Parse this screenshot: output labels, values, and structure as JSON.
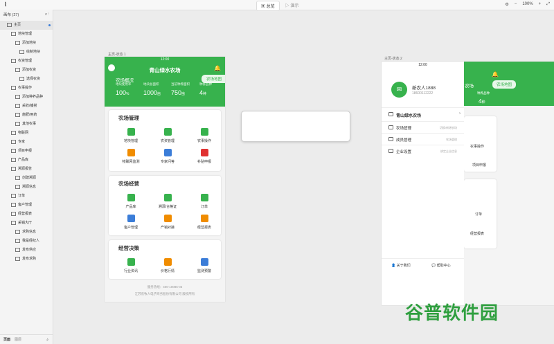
{
  "app": {
    "logo": "⌇"
  },
  "toolbar": {
    "tabs": [
      {
        "label": "总览"
      },
      {
        "label": "演示"
      }
    ],
    "zoom": "100%"
  },
  "sidebar": {
    "header": "画布 (27)",
    "items": [
      {
        "label": "主页",
        "indent": 1
      },
      {
        "label": "地块管理",
        "indent": 2
      },
      {
        "label": "添加地块",
        "indent": 3
      },
      {
        "label": "绘制地块",
        "indent": 4
      },
      {
        "label": "农资管理",
        "indent": 2
      },
      {
        "label": "添加农资",
        "indent": 3
      },
      {
        "label": "选择农资",
        "indent": 4
      },
      {
        "label": "农事操作",
        "indent": 2
      },
      {
        "label": "添加种养品种",
        "indent": 3
      },
      {
        "label": "采收/捕捞",
        "indent": 3
      },
      {
        "label": "施肥/用药",
        "indent": 3
      },
      {
        "label": "其他农事",
        "indent": 3
      },
      {
        "label": "物联网",
        "indent": 2
      },
      {
        "label": "专家",
        "indent": 2
      },
      {
        "label": "项目申报",
        "indent": 2
      },
      {
        "label": "产品库",
        "indent": 2
      },
      {
        "label": "溯源报告",
        "indent": 2
      },
      {
        "label": "创建溯源",
        "indent": 3
      },
      {
        "label": "溯源信息",
        "indent": 3
      },
      {
        "label": "订单",
        "indent": 2
      },
      {
        "label": "客户管理",
        "indent": 2
      },
      {
        "label": "经营报表",
        "indent": 2
      },
      {
        "label": "采销大厅",
        "indent": 2
      },
      {
        "label": "求购信息",
        "indent": 3
      },
      {
        "label": "我是经纪人",
        "indent": 3
      },
      {
        "label": "发布供应",
        "indent": 3
      },
      {
        "label": "发布求购",
        "indent": 3
      }
    ],
    "footer": {
      "tab1": "页面",
      "tab2": "图层"
    }
  },
  "frame1": {
    "label": "主页-状态 1",
    "time": "12:00",
    "title": "青山绿水农场",
    "overview": "农场概况",
    "map_button": "农场地图",
    "stats": [
      {
        "label": "地块使用率",
        "value": "100",
        "unit": "%"
      },
      {
        "label": "地块总面积",
        "value": "1000",
        "unit": "亩"
      },
      {
        "label": "当前种养面积",
        "value": "750",
        "unit": "亩"
      },
      {
        "label": "种养品种",
        "value": "4",
        "unit": "种"
      }
    ],
    "sections": [
      {
        "title": "农场管理",
        "items": [
          {
            "label": "地块管理",
            "color": "#37b24d"
          },
          {
            "label": "农资管理",
            "color": "#37b24d"
          },
          {
            "label": "农事操作",
            "color": "#37b24d"
          },
          {
            "label": "物联网监测",
            "color": "#f08c00"
          },
          {
            "label": "专家问答",
            "color": "#3b7dd8"
          },
          {
            "label": "补贴申报",
            "color": "#e03131"
          }
        ]
      },
      {
        "title": "农场经营",
        "items": [
          {
            "label": "产品库",
            "color": "#37b24d"
          },
          {
            "label": "溯源/合格证",
            "color": "#37b24d"
          },
          {
            "label": "订单",
            "color": "#37b24d"
          },
          {
            "label": "客户管理",
            "color": "#3b7dd8"
          },
          {
            "label": "产销对接",
            "color": "#f08c00"
          },
          {
            "label": "经营报表",
            "color": "#f08c00"
          }
        ]
      },
      {
        "title": "经营决策",
        "items": [
          {
            "label": "行业资讯",
            "color": "#37b24d"
          },
          {
            "label": "价格行情",
            "color": "#f08c00"
          },
          {
            "label": "监测预警",
            "color": "#3b7dd8"
          }
        ]
      }
    ],
    "footer_line1": "服务热线：400-10086-03",
    "footer_line2": "江苏农牧人电子商务股份有限公司 版权所有"
  },
  "frame2": {
    "label": "主页-状态 2",
    "time": "12:00",
    "username": "新农人1888",
    "phone": "18600112222",
    "farm": "青山绿水农场",
    "menu": [
      {
        "label": "农场管理",
        "sub": "切换/新增农场"
      },
      {
        "label": "成员管理",
        "sub": "农场管理"
      },
      {
        "label": "企业设置",
        "sub": "绑定企业信息"
      }
    ],
    "about": "关于我们",
    "help": "帮助中心",
    "bg_title": "农场",
    "bg_map": "农场地图",
    "bg_stat_label": "种养品种",
    "bg_stat_value": "4",
    "bg_stat_unit": "种",
    "bg_items": [
      "农事操作",
      "项目申报",
      "订单",
      "经营报表"
    ]
  },
  "watermark": "谷普软件园"
}
